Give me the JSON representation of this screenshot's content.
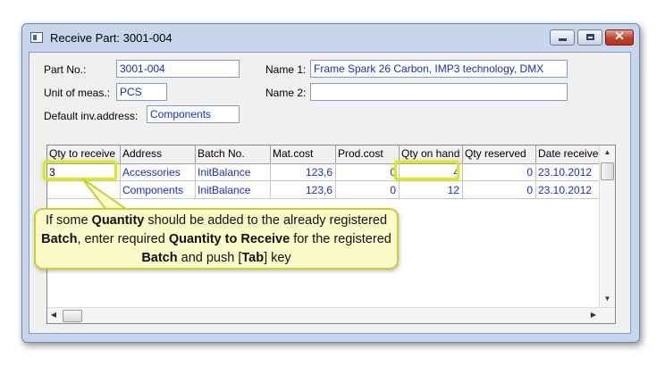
{
  "window": {
    "title": "Receive Part: 3001-004",
    "minimize_icon": "minimize-icon",
    "maximize_icon": "maximize-icon",
    "close_icon": "close-icon",
    "close_glyph": "✕"
  },
  "form": {
    "part_no_label": "Part No.:",
    "part_no_value": "3001-004",
    "unit_label": "Unit of meas.:",
    "unit_value": "PCS",
    "default_inv_label": "Default inv.address:",
    "default_inv_value": "Components",
    "name1_label": "Name 1:",
    "name1_value": "Frame Spark 26 Carbon, IMP3 technology, DMX",
    "name2_label": "Name 2:",
    "name2_value": ""
  },
  "grid": {
    "columns": [
      "Qty to receive",
      "Address",
      "Batch No.",
      "Mat.cost",
      "Prod.cost",
      "Qty on hand",
      "Qty reserved",
      "Date received"
    ],
    "rows": [
      [
        "3",
        "Accessories",
        "InitBalance",
        "123,6",
        "0",
        "4",
        "0",
        "23.10.2012"
      ],
      [
        "",
        "Components",
        "InitBalance",
        "123,6",
        "0",
        "12",
        "0",
        "23.10.2012"
      ]
    ],
    "scroll_up": "▲",
    "scroll_down": "▼",
    "scroll_left": "◀",
    "scroll_right": "▶"
  },
  "callout": {
    "t1": "If some ",
    "b1": "Quantity",
    "t2": " should be added to the already registered ",
    "b2": "Batch",
    "t3": ", enter required ",
    "b3": "Quantity to Receive",
    "t4": " for the registered ",
    "b4": "Batch",
    "t5": " and push [",
    "b5": "Tab",
    "t6": "] key"
  },
  "colors": {
    "highlight": "#dbe82a",
    "callout_bg": "#fafbc9",
    "value_text": "#1a2ec8"
  }
}
